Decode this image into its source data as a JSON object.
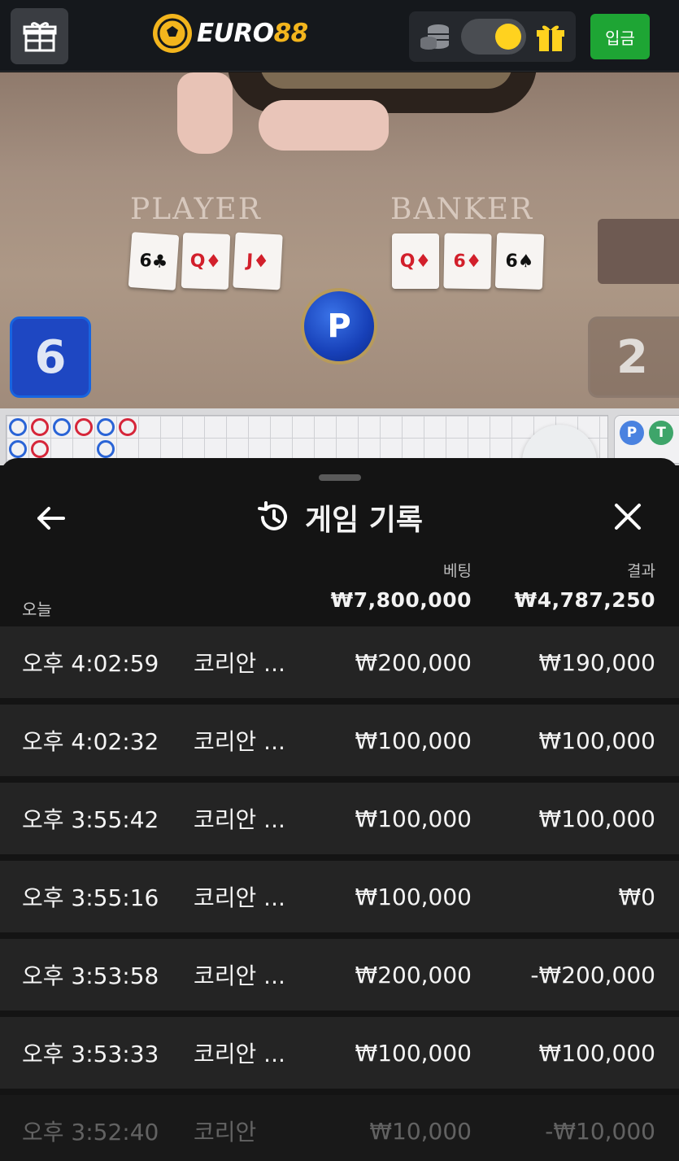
{
  "header": {
    "brand_name": "EURO",
    "brand_number": "88",
    "deposit_label": "입금",
    "accent_color": "#1ea534",
    "brand_color": "#f3b51d"
  },
  "game": {
    "player_label": "PLAYER",
    "banker_label": "BANKER",
    "player_cards": [
      {
        "rank": "6",
        "suit": "♣",
        "color": "black"
      },
      {
        "rank": "Q",
        "suit": "♦",
        "color": "red"
      },
      {
        "rank": "J",
        "suit": "♦",
        "color": "red"
      }
    ],
    "banker_cards": [
      {
        "rank": "Q",
        "suit": "♦",
        "color": "red"
      },
      {
        "rank": "6",
        "suit": "♦",
        "color": "red"
      },
      {
        "rank": "6",
        "suit": "♠",
        "color": "black"
      }
    ],
    "result_chip": "P",
    "player_score": "6",
    "banker_score": "2",
    "side_p": "P",
    "side_t": "T"
  },
  "history": {
    "title": "게임 기록",
    "today_label": "오늘",
    "bet_header": "베팅",
    "result_header": "결과",
    "total_bet": "₩7,800,000",
    "total_result": "₩4,787,250",
    "rows": [
      {
        "time": "오후 4:02:59",
        "game": "코리안 ...",
        "bet": "₩200,000",
        "result": "₩190,000"
      },
      {
        "time": "오후 4:02:32",
        "game": "코리안 ...",
        "bet": "₩100,000",
        "result": "₩100,000"
      },
      {
        "time": "오후 3:55:42",
        "game": "코리안 ...",
        "bet": "₩100,000",
        "result": "₩100,000"
      },
      {
        "time": "오후 3:55:16",
        "game": "코리안 ...",
        "bet": "₩100,000",
        "result": "₩0"
      },
      {
        "time": "오후 3:53:58",
        "game": "코리안 ...",
        "bet": "₩200,000",
        "result": "-₩200,000"
      },
      {
        "time": "오후 3:53:33",
        "game": "코리안 ...",
        "bet": "₩100,000",
        "result": "₩100,000"
      },
      {
        "time": "오후 3:52:40",
        "game": "코리안",
        "bet": "₩10,000",
        "result": "-₩10,000"
      }
    ]
  }
}
